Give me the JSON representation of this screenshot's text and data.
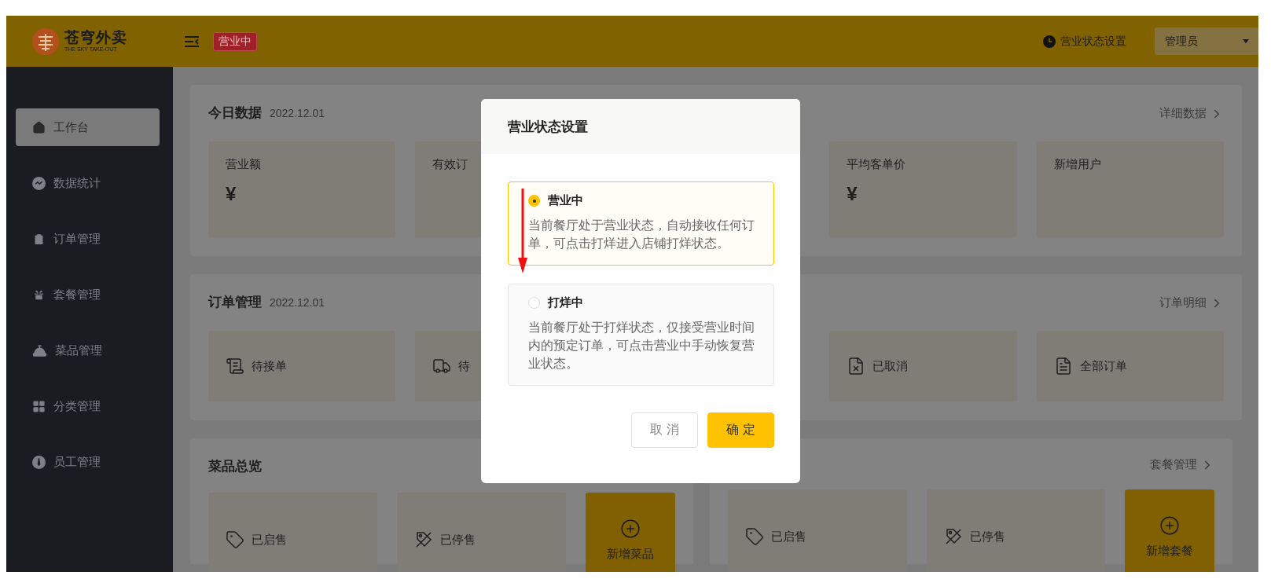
{
  "header": {
    "logo_title": "苍穹外卖",
    "logo_subtitle": "THE SKY TAKE-OUT",
    "status_badge": "营业中",
    "status_setting": "营业状态设置",
    "user": "管理员"
  },
  "sidebar": {
    "items": [
      {
        "label": "工作台",
        "selected": true
      },
      {
        "label": "数据统计",
        "selected": false
      },
      {
        "label": "订单管理",
        "selected": false
      },
      {
        "label": "套餐管理",
        "selected": false
      },
      {
        "label": "菜品管理",
        "selected": false
      },
      {
        "label": "分类管理",
        "selected": false
      },
      {
        "label": "员工管理",
        "selected": false
      }
    ]
  },
  "today": {
    "title": "今日数据",
    "date": "2022.12.01",
    "link": "详细数据",
    "cards": [
      {
        "label": "营业额",
        "value": "¥"
      },
      {
        "label": "有效订"
      },
      {
        "label": "平均客单价",
        "value": "¥"
      },
      {
        "label": "新增用户"
      }
    ]
  },
  "orders": {
    "title": "订单管理",
    "date": "2022.12.01",
    "link": "订单明细",
    "cards": [
      {
        "label": "待接单"
      },
      {
        "label": "待"
      },
      {
        "label": "已取消"
      },
      {
        "label": "全部订单"
      }
    ]
  },
  "dishes": {
    "title": "菜品总览",
    "items": [
      {
        "kind": "stat",
        "label": "已启售"
      },
      {
        "kind": "stat",
        "label": "已停售"
      },
      {
        "kind": "add",
        "label": "新增菜品"
      }
    ]
  },
  "combos": {
    "link": "套餐管理",
    "items": [
      {
        "kind": "stat",
        "label": "已启售"
      },
      {
        "kind": "stat",
        "label": "已停售"
      },
      {
        "kind": "add",
        "label": "新增套餐"
      }
    ]
  },
  "modal": {
    "title": "营业状态设置",
    "options": [
      {
        "label": "营业中",
        "description": "当前餐厅处于营业状态，自动接收任何订单，可点击打烊进入店铺打烊状态。",
        "selected": true
      },
      {
        "label": "打烊中",
        "description": "当前餐厅处于打烊状态，仅接受营业时间内的预定订单，可点击营业中手动恢复营业状态。",
        "selected": false
      }
    ],
    "buttons": [
      {
        "label": "取 消",
        "kind": "secondary"
      },
      {
        "label": "确 定",
        "kind": "primary"
      }
    ]
  }
}
